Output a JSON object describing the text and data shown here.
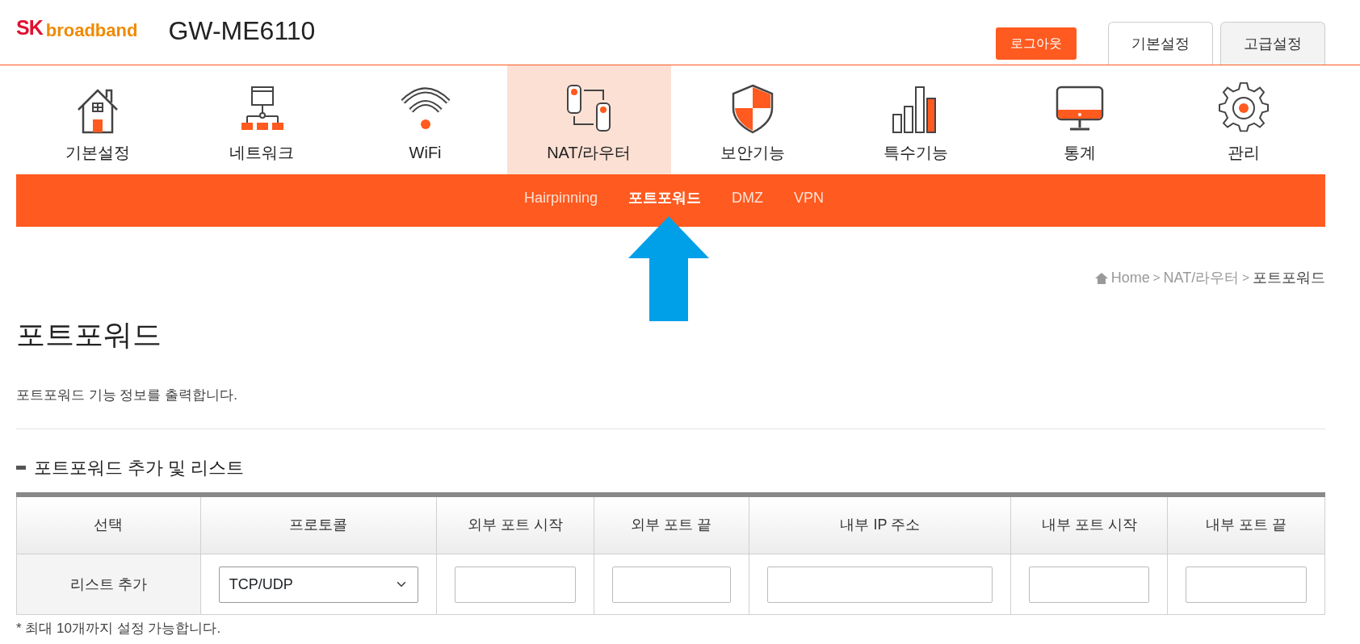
{
  "logo": {
    "mark": "SK",
    "word": "broadband"
  },
  "model": "GW-ME6110",
  "logout": "로그아웃",
  "mode_tabs": [
    {
      "label": "기본설정",
      "selected": true
    },
    {
      "label": "고급설정",
      "selected": false
    }
  ],
  "main_menu": [
    {
      "label": "기본설정",
      "kind": "home",
      "selected": false
    },
    {
      "label": "네트워크",
      "kind": "network",
      "selected": false
    },
    {
      "label": "WiFi",
      "kind": "wifi",
      "selected": false
    },
    {
      "label": "NAT/라우터",
      "kind": "nat",
      "selected": true
    },
    {
      "label": "보안기능",
      "kind": "shield",
      "selected": false
    },
    {
      "label": "특수기능",
      "kind": "bars",
      "selected": false
    },
    {
      "label": "통계",
      "kind": "monitor",
      "selected": false
    },
    {
      "label": "관리",
      "kind": "gear",
      "selected": false
    }
  ],
  "sub_menu": [
    {
      "label": "Hairpinning",
      "selected": false
    },
    {
      "label": "포트포워드",
      "selected": true
    },
    {
      "label": "DMZ",
      "selected": false
    },
    {
      "label": "VPN",
      "selected": false
    }
  ],
  "breadcrumb": [
    "Home",
    ">",
    "NAT/라우터",
    ">",
    "포트포워드"
  ],
  "page_title": "포트포워드",
  "description": "포트포워드 기능 정보를 출력합니다.",
  "section_title": "포트포워드 추가 및 리스트",
  "table": {
    "columns": [
      "선택",
      "프로토콜",
      "외부 포트 시작",
      "외부 포트 끝",
      "내부 IP 주소",
      "내부 포트 시작",
      "내부 포트 끝"
    ],
    "rows": [
      {
        "cells": [
          {
            "kind": "label",
            "value": "리스트 추가"
          },
          {
            "kind": "select",
            "value": "TCP/UDP"
          },
          {
            "kind": "input"
          },
          {
            "kind": "input"
          },
          {
            "kind": "input"
          },
          {
            "kind": "input"
          },
          {
            "kind": "input"
          }
        ]
      }
    ]
  },
  "note": "* 최대 10개까지 설정 가능합니다."
}
